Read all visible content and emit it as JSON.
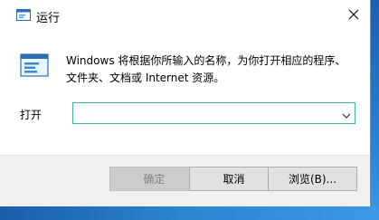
{
  "window": {
    "title": "运行",
    "description": "Windows 将根据你所输入的名称，为你打开相应的程序、文件夹、文档或 Internet 资源。",
    "icons": {
      "app": "run-icon",
      "close": "close-icon",
      "dropdown": "chevron-down-icon"
    }
  },
  "form": {
    "open_label": "打开",
    "open_value": ""
  },
  "buttons": {
    "ok": "确定",
    "cancel": "取消",
    "browse": "浏览(B)..."
  },
  "colors": {
    "accent_border": "#3fb2a6",
    "footer_bg": "#f0f0f0",
    "disabled_text": "#838383"
  }
}
